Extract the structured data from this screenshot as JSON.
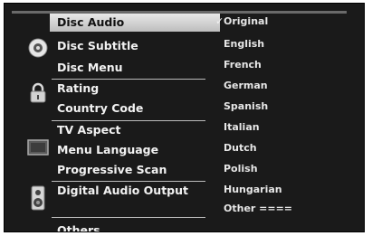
{
  "menu": {
    "groups": [
      {
        "icon": "disc-icon",
        "items": [
          "Disc Audio",
          "Disc Subtitle",
          "Disc Menu"
        ]
      },
      {
        "icon": "lock-icon",
        "items": [
          "Rating",
          "Country Code"
        ]
      },
      {
        "icon": "tv-icon",
        "items": [
          "TV Aspect",
          "Menu Language",
          "Progressive Scan"
        ]
      },
      {
        "icon": "speaker-icon",
        "items": [
          "Digital Audio Output"
        ]
      },
      {
        "icon": "",
        "items": [
          "Others"
        ]
      }
    ],
    "selected": "Disc Audio"
  },
  "options": {
    "check_mark": "✓",
    "selected": "Original",
    "items": [
      "Original",
      "English",
      "French",
      "German",
      "Spanish",
      "Italian",
      "Dutch",
      "Polish",
      "Hungarian",
      "Other ===="
    ]
  }
}
